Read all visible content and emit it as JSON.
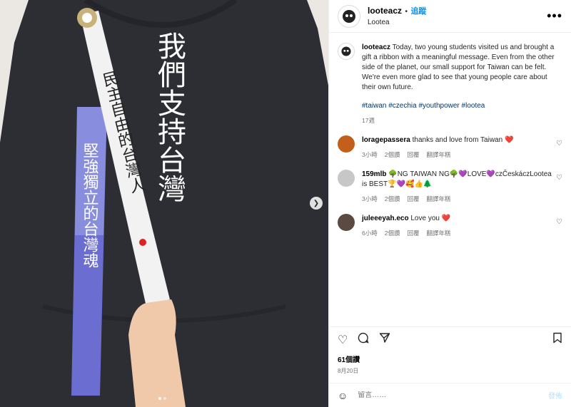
{
  "post": {
    "username": "looteacz",
    "separator": "•",
    "follow_label": "追蹤",
    "subtitle": "Lootea",
    "photo_text": "我們支持台灣",
    "caption": {
      "username": "looteacz",
      "text": "Today, two young students visited us and brought a gift a ribbon with a meaningful message. Even from the other side of the planet, our small support for Taiwan can be felt. We're even more glad to see that young people care about their own future.",
      "hashtags": "#taiwan #czechia #youthpower #lootea",
      "time": "17週"
    },
    "likes": "61個讚",
    "date": "8月20日"
  },
  "comments": [
    {
      "user": "loragepassera",
      "text": "thanks and love from Taiwan ❤️",
      "time": "3小時",
      "likes": "2個讚",
      "reply": "回覆",
      "translate": "翻譯年糕",
      "avatar_color": "#c2601b"
    },
    {
      "user": "159mlb",
      "text": "🌳NG TAIWAN NG🌳💜LOVE💜czČeskáczLootea is BEST🏆💜🥰👍🌲",
      "time": "3小時",
      "likes": "2個讚",
      "reply": "回覆",
      "translate": "翻譯年糕",
      "avatar_color": "#c7c7c7"
    },
    {
      "user": "juleeeyah.eco",
      "text": "Love you ❤️",
      "time": "6小時",
      "likes": "2個讚",
      "reply": "回覆",
      "translate": "翻譯年糕",
      "avatar_color": "#5b4a3f"
    }
  ],
  "compose": {
    "placeholder": "留言……",
    "post_label": "發佈"
  },
  "icons": [
    "more-icon",
    "heart-icon",
    "comment-icon",
    "share-icon",
    "bookmark-icon",
    "emoji-icon",
    "chevron-right-icon"
  ],
  "colors": {
    "accent": "#0095f6",
    "hashtag": "#00376b",
    "meta": "#737373"
  }
}
